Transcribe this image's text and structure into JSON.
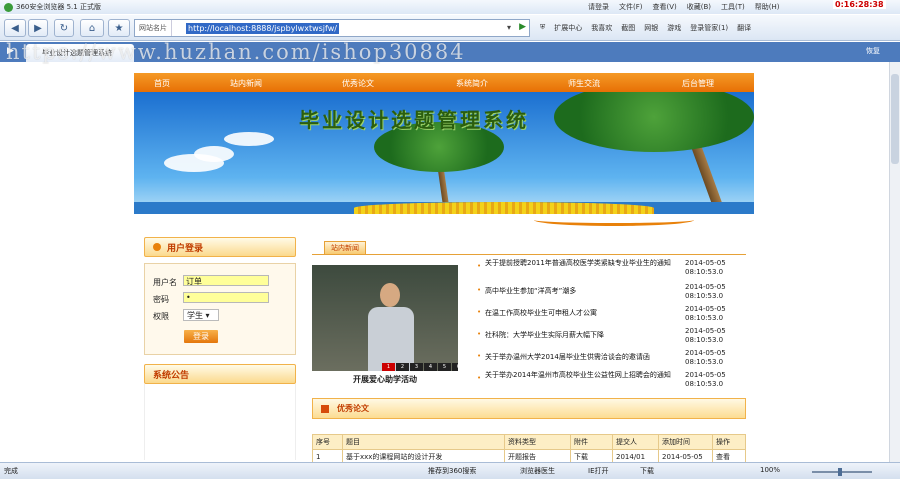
{
  "browser": {
    "title": "360安全浏览器 5.1 正式版",
    "menus": [
      "请登录",
      "文件(F)",
      "查看(V)",
      "收藏(B)",
      "工具(T)",
      "帮助(H)"
    ],
    "clock": "0:16:28:38",
    "address_site": "网站名片",
    "url": "http://localhost:8888/jspbylwxtwsjfw/",
    "tools": [
      "扩展中心",
      "我喜欢",
      "截图",
      "网银",
      "游戏",
      "登录管家(1)",
      "翻译"
    ],
    "tab_title": "毕业设计选题管理系统",
    "tab_right": "恢复",
    "watermark": "https://www.huzhan.com/ishop30884"
  },
  "site": {
    "nav": [
      "首页",
      "站内新闻",
      "优秀论文",
      "系统简介",
      "师生交流",
      "后台管理"
    ],
    "banner_title": "毕业设计选题管理系统"
  },
  "login": {
    "header": "用户登录",
    "username_label": "用户名",
    "username_value": "订单",
    "password_label": "密码",
    "password_value": "•",
    "role_label": "权限",
    "role_value": "学生",
    "submit": "登录"
  },
  "notice": {
    "header": "系统公告"
  },
  "news": {
    "header": "站内新闻",
    "photo_caption": "开展爱心助学活动",
    "photo_pages": [
      "1",
      "2",
      "3",
      "4",
      "5",
      "6"
    ],
    "items": [
      {
        "title": "关于提前授聘2011年普通高校医学类紧缺专业毕业生的通知",
        "date": "2014-05-05",
        "time": "08:10:53.0"
      },
      {
        "title": "高中毕业生参加“洋高考”潮多",
        "date": "2014-05-05",
        "time": "08:10:53.0"
      },
      {
        "title": "在温工作高校毕业生可申租人才公寓",
        "date": "2014-05-05",
        "time": "08:10:53.0"
      },
      {
        "title": "社科院：大学毕业生实际月薪大幅下降",
        "date": "2014-05-05",
        "time": "08:10:53.0"
      },
      {
        "title": "关于举办温州大学2014届毕业生供需洽谈会的邀请函",
        "date": "2014-05-05",
        "time": "08:10:53.0"
      },
      {
        "title": "关于举办2014年温州市高校毕业生公益性网上招聘会的通知",
        "date": "2014-05-05",
        "time": "08:10:53.0"
      }
    ]
  },
  "excellent": {
    "header": "优秀论文",
    "columns": [
      "序号",
      "题目",
      "资料类型",
      "附件",
      "提交人",
      "添加时间",
      "操作"
    ],
    "rows": [
      [
        "1",
        "基于xxx的课程网站的设计开发",
        "开题报告",
        "下载",
        "2014/01",
        "2014-05-05",
        "查看"
      ]
    ]
  },
  "statusbar": {
    "left": "完成",
    "items": [
      "推荐到360搜索",
      "浏览器医生",
      "IE打开",
      "下载"
    ],
    "zoom": "100%"
  }
}
